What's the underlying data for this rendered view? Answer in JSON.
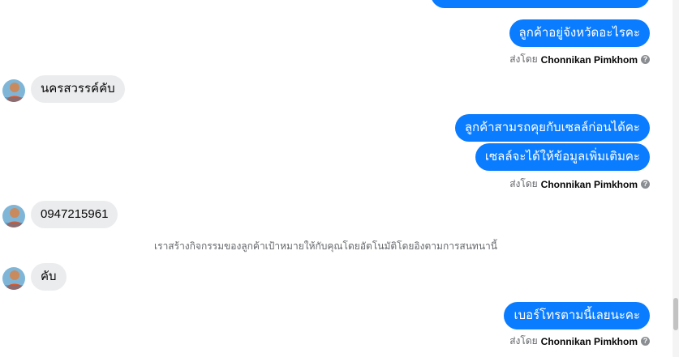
{
  "conversation": {
    "messages": [
      {
        "type": "out",
        "text": "ลูกค้าอยู่จังหวัดอะไรคะ"
      },
      {
        "type": "in",
        "text": "นครสวรรค์คับ"
      },
      {
        "type": "out",
        "text": "ลูกค้าสามรถคุยกับเซลล์ก่อนได้คะ"
      },
      {
        "type": "out",
        "text": "เซลล์จะได้ให้ข้อมูลเพิ่มเติมคะ"
      },
      {
        "type": "in",
        "text": "0947215961"
      },
      {
        "type": "in",
        "text": "คับ"
      },
      {
        "type": "out",
        "text": "เบอร์โทรตามนี้เลยนะคะ"
      }
    ],
    "sent_by_prefix": "ส่งโดย",
    "sender_name": "Chonnikan Pimkhom",
    "system_notice": "เราสร้างกิจกรรมของลูกค้าเป้าหมายให้กับคุณโดยอัตโนมัติโดยอิงตามการสนทนานี้",
    "info_glyph": "?"
  },
  "colors": {
    "outgoing_bubble": "#0a7cff",
    "incoming_bubble": "#ebecee",
    "meta_text": "#65676b"
  }
}
